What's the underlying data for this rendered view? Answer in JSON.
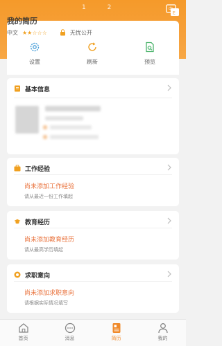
{
  "header": {
    "pager": "1 2",
    "name": "我的简历",
    "language": "中文",
    "rating_stars": "★★☆☆☆",
    "visibility": "无忧公开"
  },
  "actions": [
    {
      "label": "设置",
      "icon": "gear-icon"
    },
    {
      "label": "刷新",
      "icon": "refresh-icon"
    },
    {
      "label": "预览",
      "icon": "preview-icon"
    }
  ],
  "sections": {
    "basic": {
      "title": "基本信息"
    },
    "work": {
      "title": "工作经验",
      "empty_title": "尚未添加工作经验",
      "empty_hint": "请从最近一份工作填起"
    },
    "education": {
      "title": "教育经历",
      "empty_title": "尚未添加教育经历",
      "empty_hint": "请从最高学历填起"
    },
    "intention": {
      "title": "求职意向",
      "empty_title": "尚未添加求职意向",
      "empty_hint": "请根据实际情况填写"
    }
  },
  "tabs": [
    {
      "label": "首页",
      "icon": "home-icon"
    },
    {
      "label": "消息",
      "icon": "message-icon"
    },
    {
      "label": "简历",
      "icon": "resume-icon",
      "active": true
    },
    {
      "label": "我的",
      "icon": "profile-icon"
    }
  ],
  "colors": {
    "brand": "#f59a2a",
    "accent_text": "#e9723c",
    "active_tab": "#f08a2a"
  }
}
